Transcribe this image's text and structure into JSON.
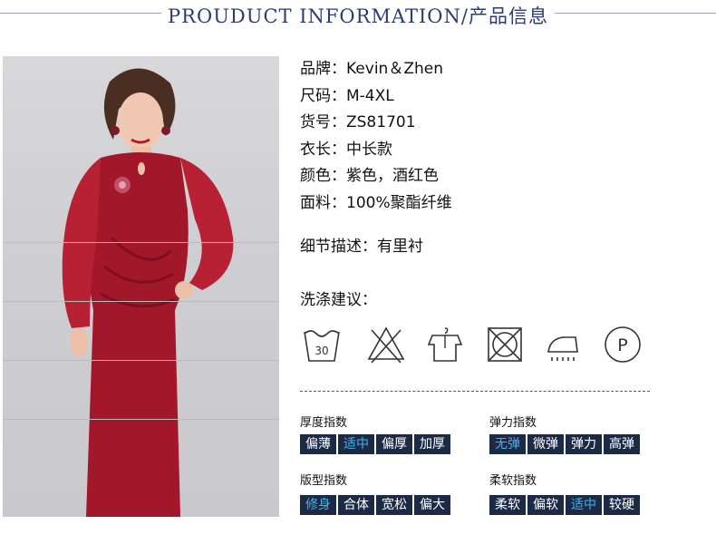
{
  "header": {
    "title": "PROUDUCT INFORMATION/产品信息"
  },
  "product": {
    "brand": "品牌：Kevin＆Zhen",
    "size": "尺码：M-4XL",
    "item_no": "货号：ZS81701",
    "length": "衣长：中长款",
    "color": "颜色：紫色，酒红色",
    "fabric": "面料：100%聚酯纤维"
  },
  "detail": "细节描述：有里衬",
  "wash": {
    "title": "洗涤建议：",
    "icons": [
      "wash-30-icon",
      "no-bleach-icon",
      "hang-dry-icon",
      "no-tumble-dry-icon",
      "iron-icon",
      "dry-clean-p-icon"
    ],
    "temp_label": "30",
    "p_label": "P"
  },
  "indices": {
    "thickness": {
      "title": "厚度指数",
      "options": [
        "偏薄",
        "适中",
        "偏厚",
        "加厚"
      ],
      "selected": 1
    },
    "elasticity": {
      "title": "弹力指数",
      "options": [
        "无弹",
        "微弹",
        "弹力",
        "高弹"
      ],
      "selected": 0
    },
    "fit": {
      "title": "版型指数",
      "options": [
        "修身",
        "合体",
        "宽松",
        "偏大"
      ],
      "selected": 0
    },
    "softness": {
      "title": "柔软指数",
      "options": [
        "柔软",
        "偏软",
        "适中",
        "较硬"
      ],
      "selected": 2
    }
  },
  "colors": {
    "dress": "#a3172b",
    "nav": "#1c2a46",
    "highlight": "#3fb4f0",
    "title": "#2d3a78"
  }
}
